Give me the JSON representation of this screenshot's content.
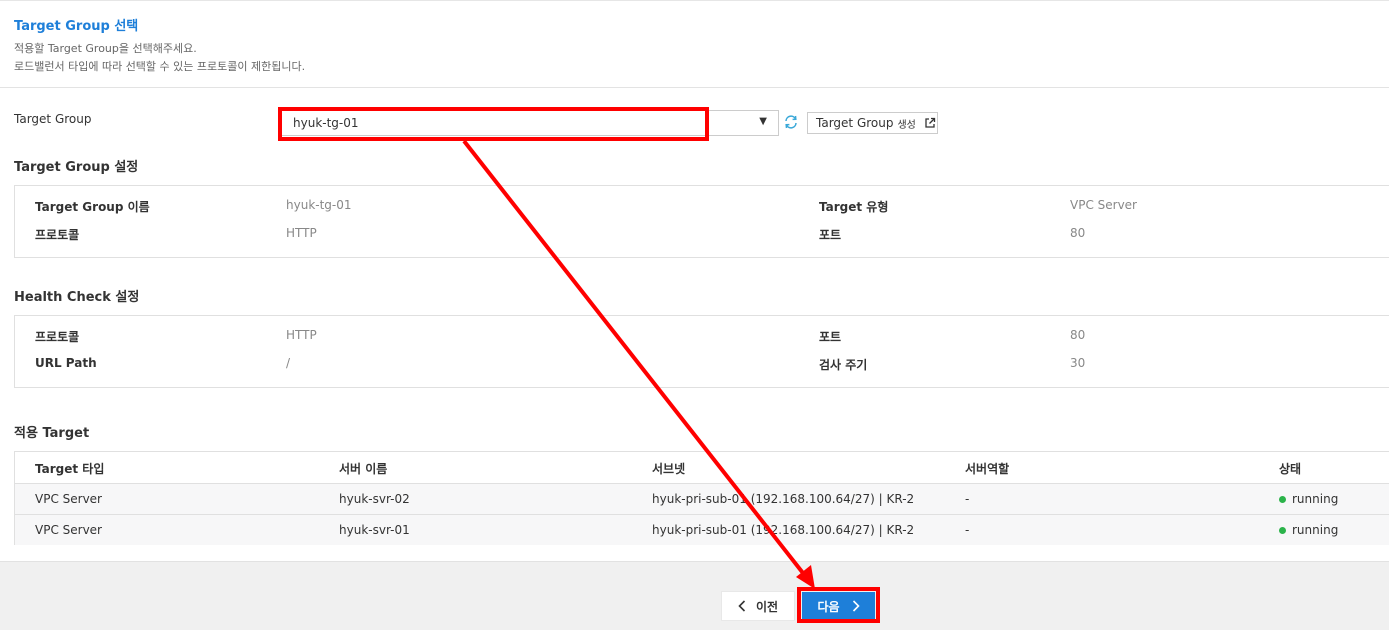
{
  "header": {
    "title": "Target Group 선택",
    "desc1": "적용할 Target Group을 선택해주세요.",
    "desc2": "로드밸런서 타입에 따라 선택할 수 있는 프로토콜이 제한됩니다."
  },
  "target_group": {
    "label": "Target Group",
    "selected": "hyuk-tg-01",
    "create_label": "Target Group",
    "create_suffix": "생성"
  },
  "tg_settings": {
    "title": "Target Group 설정",
    "name_key": "Target Group 이름",
    "name_val": "hyuk-tg-01",
    "type_key": "Target 유형",
    "type_val": "VPC Server",
    "proto_key": "프로토콜",
    "proto_val": "HTTP",
    "port_key": "포트",
    "port_val": "80"
  },
  "health_check": {
    "title": "Health Check 설정",
    "proto_key": "프로토콜",
    "proto_val": "HTTP",
    "port_key": "포트",
    "port_val": "80",
    "path_key": "URL Path",
    "path_val": "/",
    "interval_key": "검사 주기",
    "interval_val": "30"
  },
  "targets": {
    "title": "적용 Target",
    "columns": [
      "Target 타입",
      "서버 이름",
      "서브넷",
      "서버역할",
      "상태"
    ],
    "rows": [
      [
        "VPC Server",
        "hyuk-svr-02",
        "hyuk-pri-sub-01 (192.168.100.64/27) | KR-2",
        "-",
        "running"
      ],
      [
        "VPC Server",
        "hyuk-svr-01",
        "hyuk-pri-sub-01 (192.168.100.64/27) | KR-2",
        "-",
        "running"
      ]
    ]
  },
  "footer": {
    "prev_label": "이전",
    "next_label": "다음"
  },
  "colors": {
    "accent": "#1e7fd9",
    "status_running": "#2bb34a",
    "annotation": "#ff0000"
  }
}
